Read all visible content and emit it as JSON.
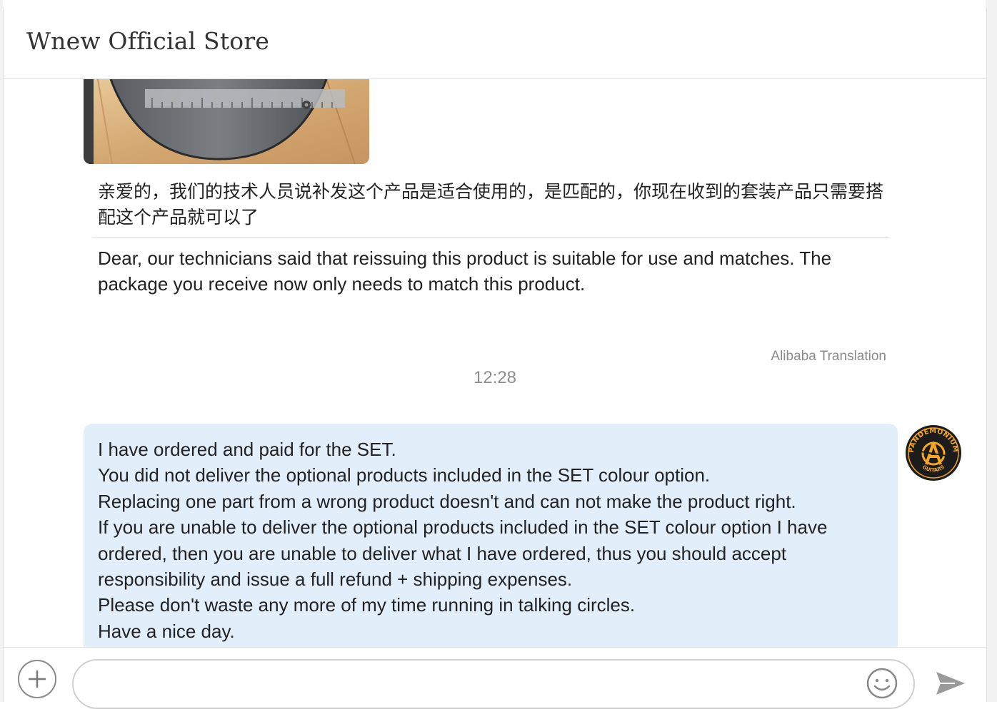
{
  "header": {
    "title": "Wnew Official Store"
  },
  "messages": {
    "seller": {
      "original_text": "亲爱的，我们的技术人员说补发这个产品是适合使用的，是匹配的，你现在收到的套装产品只需要搭配这个产品就可以了",
      "translated_text": "Dear, our technicians said that reissuing this product is suitable for use and matches. The package you receive now only needs to match this product.",
      "translation_credit": "Alibaba Translation"
    },
    "timestamp": "12:28",
    "user": {
      "lines": [
        "I have ordered and paid for the SET.",
        "You did not deliver the optional products included in the SET colour option.",
        "Replacing one part from a wrong product doesn't and can not make the product right.",
        "If you are unable to deliver the optional products included in the SET colour option I have ordered, then you are unable to deliver what I have ordered, thus you should accept responsibility and issue a full refund + shipping expenses.",
        "Please don't waste any more of my time running in talking circles.",
        "Have a nice day."
      ],
      "avatar": {
        "logo_text": "PANDEMONIUM",
        "logo_subtext": "GUITARS"
      }
    }
  },
  "composer": {
    "input_placeholder": "",
    "icons": {
      "add": "plus-icon",
      "emoji": "smiley-icon",
      "send": "send-icon"
    }
  },
  "colors": {
    "user_bubble": "#e3eefb",
    "avatar_accent": "#f5a623"
  }
}
